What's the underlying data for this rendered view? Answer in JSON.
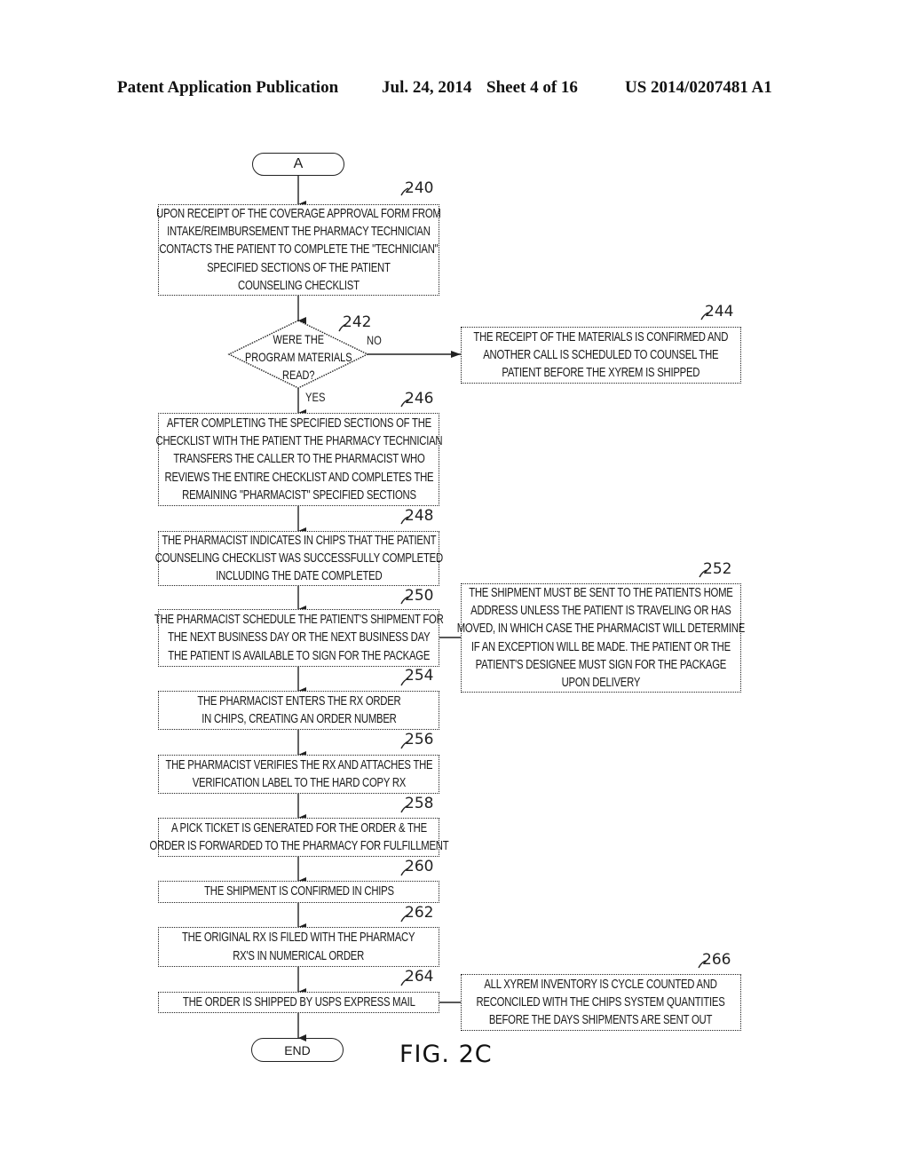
{
  "header": {
    "publication": "Patent Application Publication",
    "date": "Jul. 24, 2014",
    "sheet": "Sheet 4 of 16",
    "number": "US 2014/0207481 A1"
  },
  "figure_label": "FIG. 2C",
  "start_connector": "A",
  "end_terminal": "END",
  "decision": {
    "ref": "242",
    "lines": [
      "WERE THE",
      "PROGRAM MATERIALS",
      "READ?"
    ],
    "yes_label": "YES",
    "no_label": "NO"
  },
  "steps": {
    "s240": {
      "ref": "240",
      "lines": [
        "UPON RECEIPT OF THE COVERAGE APPROVAL FORM FROM",
        "INTAKE/REIMBURSEMENT THE PHARMACY TECHNICIAN",
        "CONTACTS THE PATIENT TO COMPLETE THE \"TECHNICIAN\"",
        "SPECIFIED SECTIONS OF THE PATIENT",
        "COUNSELING CHECKLIST"
      ]
    },
    "s244": {
      "ref": "244",
      "lines": [
        "THE RECEIPT OF THE MATERIALS IS CONFIRMED AND",
        "ANOTHER CALL IS SCHEDULED TO COUNSEL THE",
        "PATIENT BEFORE THE XYREM IS SHIPPED"
      ]
    },
    "s246": {
      "ref": "246",
      "lines": [
        "AFTER COMPLETING THE SPECIFIED SECTIONS OF THE",
        "CHECKLIST WITH THE PATIENT THE PHARMACY TECHNICIAN",
        "TRANSFERS THE CALLER TO THE PHARMACIST WHO",
        "REVIEWS THE ENTIRE CHECKLIST AND COMPLETES THE",
        "REMAINING \"PHARMACIST\" SPECIFIED SECTIONS"
      ]
    },
    "s248": {
      "ref": "248",
      "lines": [
        "THE PHARMACIST INDICATES IN CHiPS THAT THE PATIENT",
        "COUNSELING CHECKLIST WAS SUCCESSFULLY COMPLETED",
        "INCLUDING THE DATE COMPLETED"
      ]
    },
    "s250": {
      "ref": "250",
      "lines": [
        "THE PHARMACIST SCHEDULE THE PATIENT'S SHIPMENT FOR",
        "THE NEXT BUSINESS DAY OR THE NEXT BUSINESS DAY",
        "THE PATIENT IS AVAILABLE TO SIGN FOR THE PACKAGE"
      ]
    },
    "s252": {
      "ref": "252",
      "lines": [
        "THE SHIPMENT MUST BE SENT TO THE PATIENTS HOME",
        "ADDRESS UNLESS THE PATIENT IS TRAVELING OR HAS",
        "MOVED, IN WHICH CASE THE PHARMACIST WILL DETERMINE",
        "IF AN EXCEPTION WILL BE MADE. THE PATIENT OR THE",
        "PATIENT'S DESIGNEE MUST SIGN FOR THE PACKAGE",
        "UPON DELIVERY"
      ]
    },
    "s254": {
      "ref": "254",
      "lines": [
        "THE PHARMACIST ENTERS THE Rx ORDER",
        "IN CHiPS, CREATING AN ORDER NUMBER"
      ]
    },
    "s256": {
      "ref": "256",
      "lines": [
        "THE PHARMACIST VERIFIES THE Rx AND ATTACHES THE",
        "VERIFICATION LABEL TO THE HARD COPY Rx"
      ]
    },
    "s258": {
      "ref": "258",
      "lines": [
        "A PICK TICKET IS GENERATED FOR THE ORDER & THE",
        "ORDER IS FORWARDED TO THE PHARMACY FOR FULFILLMENT"
      ]
    },
    "s260": {
      "ref": "260",
      "lines": [
        "THE SHIPMENT IS CONFIRMED IN CHiPS"
      ]
    },
    "s262": {
      "ref": "262",
      "lines": [
        "THE ORIGINAL Rx IS FILED WITH THE PHARMACY",
        "Rx'S IN NUMERICAL ORDER"
      ]
    },
    "s264": {
      "ref": "264",
      "lines": [
        "THE ORDER IS SHIPPED BY USPS EXPRESS MAIL"
      ]
    },
    "s266": {
      "ref": "266",
      "lines": [
        "ALL XYREM INVENTORY IS CYCLE COUNTED AND",
        "RECONCILED WITH THE CHiPS SYSTEM QUANTITIES",
        "BEFORE THE DAYS SHIPMENTS ARE SENT OUT"
      ]
    }
  }
}
